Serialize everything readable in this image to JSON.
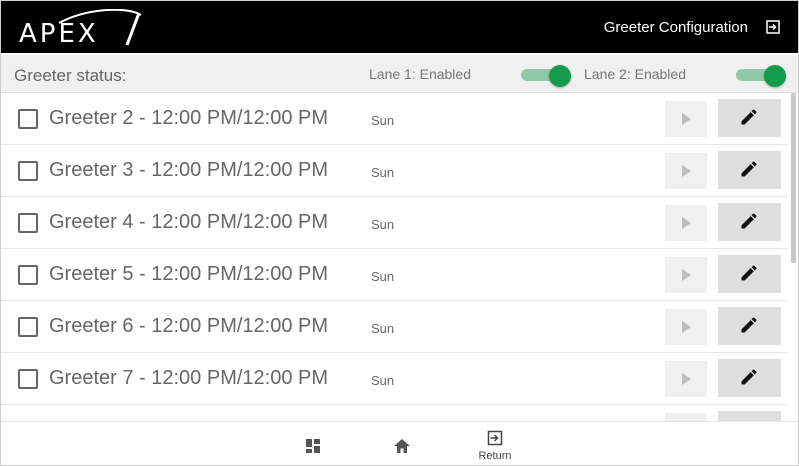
{
  "header": {
    "logo_text": "APEX",
    "title": "Greeter Configuration",
    "logout_icon": "logout-icon"
  },
  "status": {
    "label": "Greeter status:",
    "lane1": {
      "label": "Lane 1: Enabled",
      "enabled": true
    },
    "lane2": {
      "label": "Lane 2: Enabled",
      "enabled": true
    },
    "toggle_color": "#129b4a"
  },
  "greeters": [
    {
      "name": "Greeter 2 - 12:00 PM/12:00 PM",
      "day": "Sun",
      "checked": false
    },
    {
      "name": "Greeter 3 - 12:00 PM/12:00 PM",
      "day": "Sun",
      "checked": false
    },
    {
      "name": "Greeter 4 - 12:00 PM/12:00 PM",
      "day": "Sun",
      "checked": false
    },
    {
      "name": "Greeter 5 - 12:00 PM/12:00 PM",
      "day": "Sun",
      "checked": false
    },
    {
      "name": "Greeter 6 - 12:00 PM/12:00 PM",
      "day": "Sun",
      "checked": false
    },
    {
      "name": "Greeter 7 - 12:00 PM/12:00 PM",
      "day": "Sun",
      "checked": false
    }
  ],
  "footer": {
    "apps_icon": "apps-grid-icon",
    "home_icon": "home-icon",
    "return_icon": "return-icon",
    "return_label": "Return"
  }
}
